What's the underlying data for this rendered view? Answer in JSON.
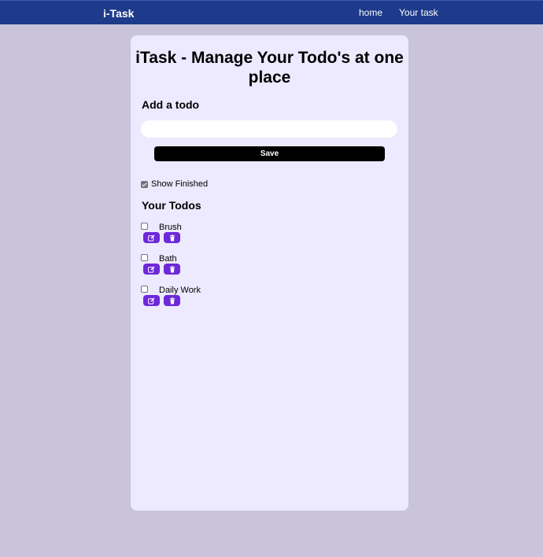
{
  "navbar": {
    "brand": "i-Task",
    "links": [
      {
        "label": "home"
      },
      {
        "label": "Your task"
      }
    ]
  },
  "main": {
    "title": "iTask - Manage Your Todo's at one place",
    "add_heading": "Add a todo",
    "input": {
      "value": "",
      "placeholder": ""
    },
    "save_label": "Save",
    "show_finished": {
      "label": "Show Finished",
      "checked": true
    },
    "todos_heading": "Your Todos",
    "todos": [
      {
        "text": "Brush",
        "done": false
      },
      {
        "text": "Bath",
        "done": false
      },
      {
        "text": "Daily Work",
        "done": false
      }
    ],
    "icons": {
      "edit": "edit-icon",
      "delete": "trash-icon"
    }
  },
  "colors": {
    "page_bg": "#c9c4da",
    "navbar_bg": "#1e3a8a",
    "card_bg": "#ede9fe",
    "action_button": "#6d28d9",
    "save_button": "#000000"
  }
}
